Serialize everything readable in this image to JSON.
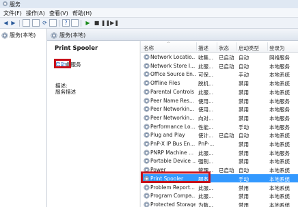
{
  "window": {
    "title": "服务"
  },
  "menu": [
    "文件(F)",
    "操作(A)",
    "查看(V)",
    "帮助(H)"
  ],
  "tree": {
    "root": "服务(本地)"
  },
  "header": {
    "title": "服务(本地)"
  },
  "detail": {
    "service_name": "Print Spooler",
    "start_link": "启动",
    "start_suffix": "此服务",
    "desc_label": "描述:",
    "desc_text": "服务描述"
  },
  "columns": [
    "名称",
    "描述",
    "状态",
    "启动类型",
    "登录为"
  ],
  "rows": [
    [
      "Network Locatio...",
      "收集...",
      "已启动",
      "自动",
      "网络服务"
    ],
    [
      "Network Store I...",
      "此服...",
      "已启动",
      "自动",
      "本地服务"
    ],
    [
      "Office Source En...",
      "可保...",
      "",
      "手动",
      "本地系统"
    ],
    [
      "Offline Files",
      "脱机...",
      "",
      "禁用",
      "本地系统"
    ],
    [
      "Parental Controls",
      "此服...",
      "",
      "禁用",
      "本地系统"
    ],
    [
      "Peer Name Res...",
      "使用...",
      "",
      "禁用",
      "本地服务"
    ],
    [
      "Peer Networkin...",
      "使用...",
      "",
      "禁用",
      "本地服务"
    ],
    [
      "Peer Networkin...",
      "向对...",
      "",
      "禁用",
      "本地服务"
    ],
    [
      "Performance Lo...",
      "性能...",
      "",
      "手动",
      "本地服务"
    ],
    [
      "Plug and Play",
      "使计...",
      "已启动",
      "自动",
      "本地系统"
    ],
    [
      "PnP-X IP Bus En...",
      "PnP-...",
      "",
      "禁用",
      "本地系统"
    ],
    [
      "PNRP Machine ...",
      "此服...",
      "",
      "禁用",
      "本地服务"
    ],
    [
      "Portable Device ...",
      "强制...",
      "",
      "禁用",
      "本地系统"
    ],
    [
      "Power",
      "管理...",
      "已启动",
      "自动",
      "本地系统"
    ],
    [
      "Print Spooler",
      "服务",
      "",
      "手动",
      "本地系统"
    ],
    [
      "Problem Report...",
      "此服...",
      "",
      "禁用",
      "本地系统"
    ],
    [
      "Program Compa...",
      "此服...",
      "",
      "禁用",
      "本地系统"
    ],
    [
      "Protected Storage",
      "为数...",
      "",
      "禁用",
      "本地系统"
    ]
  ],
  "selected_row": 14,
  "colors": {
    "selection": "#3399ff",
    "highlight_box": "#c8101a",
    "link": "#0b58b8"
  }
}
